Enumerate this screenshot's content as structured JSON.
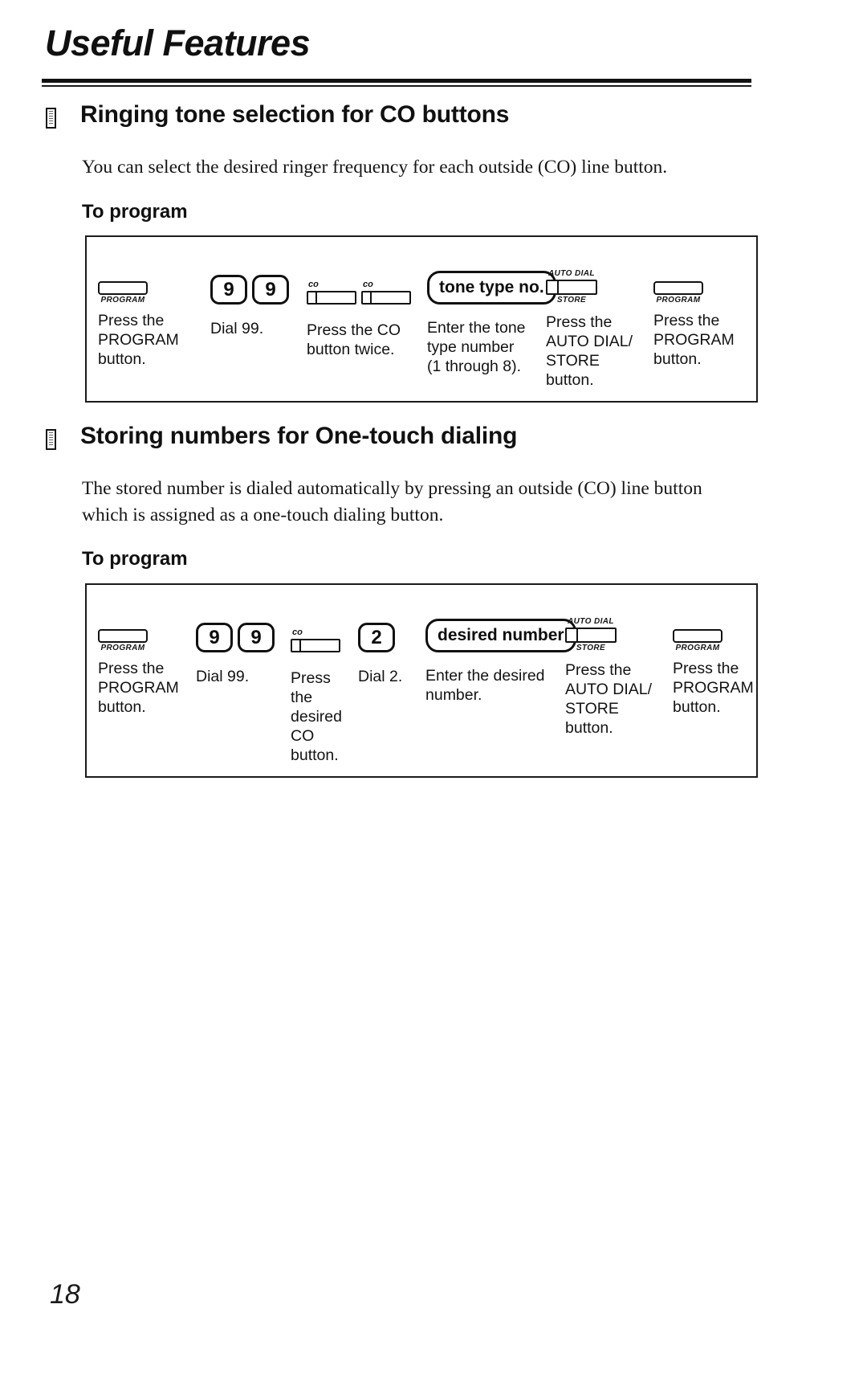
{
  "document": {
    "title": "Useful Features",
    "page_number": "18"
  },
  "sections": [
    {
      "heading": "Ringing tone selection for CO buttons",
      "body": "You can select the desired ringer frequency for each outside (CO) line button.",
      "subheading": "To program",
      "steps": [
        {
          "icons": [
            {
              "type": "program-button",
              "label_below": "PROGRAM"
            }
          ],
          "caption": "Press the\nPROGRAM\nbutton."
        },
        {
          "icons": [
            {
              "type": "keypad-key",
              "digit": "9"
            },
            {
              "type": "keypad-key",
              "digit": "9"
            }
          ],
          "caption": "Dial 99."
        },
        {
          "icons": [
            {
              "type": "co-button",
              "label_above": "co"
            },
            {
              "type": "co-button",
              "label_above": "co"
            }
          ],
          "caption": "Press the CO\nbutton twice."
        },
        {
          "icons": [
            {
              "type": "capsule",
              "text": "tone type no."
            }
          ],
          "caption": "Enter the tone\ntype number\n(1 through 8)."
        },
        {
          "icons": [
            {
              "type": "auto-dial-store-button",
              "label_above": "AUTO DIAL",
              "label_below": "STORE"
            }
          ],
          "caption": "Press the\nAUTO DIAL/\nSTORE\nbutton."
        },
        {
          "icons": [
            {
              "type": "program-button",
              "label_below": "PROGRAM"
            }
          ],
          "caption": "Press the\nPROGRAM\nbutton."
        }
      ]
    },
    {
      "heading": "Storing numbers for One-touch dialing",
      "body": "The stored number is dialed automatically by pressing an outside (CO) line button which is assigned as a one-touch dialing button.",
      "subheading": "To program",
      "steps": [
        {
          "icons": [
            {
              "type": "program-button",
              "label_below": "PROGRAM"
            }
          ],
          "caption": "Press the\nPROGRAM\nbutton."
        },
        {
          "icons": [
            {
              "type": "keypad-key",
              "digit": "9"
            },
            {
              "type": "keypad-key",
              "digit": "9"
            }
          ],
          "caption": "Dial 99."
        },
        {
          "icons": [
            {
              "type": "co-button",
              "label_above": "co"
            }
          ],
          "caption": "Press\nthe\ndesired\nCO button."
        },
        {
          "icons": [
            {
              "type": "keypad-key",
              "digit": "2"
            }
          ],
          "caption": "Dial 2."
        },
        {
          "icons": [
            {
              "type": "capsule",
              "text": "desired number"
            }
          ],
          "caption": "Enter the desired\nnumber."
        },
        {
          "icons": [
            {
              "type": "auto-dial-store-button",
              "label_above": "AUTO DIAL",
              "label_below": "STORE"
            }
          ],
          "caption": "Press the\nAUTO DIAL/\nSTORE button."
        },
        {
          "icons": [
            {
              "type": "program-button",
              "label_below": "PROGRAM"
            }
          ],
          "caption": "Press the\nPROGRAM\nbutton."
        }
      ]
    }
  ]
}
